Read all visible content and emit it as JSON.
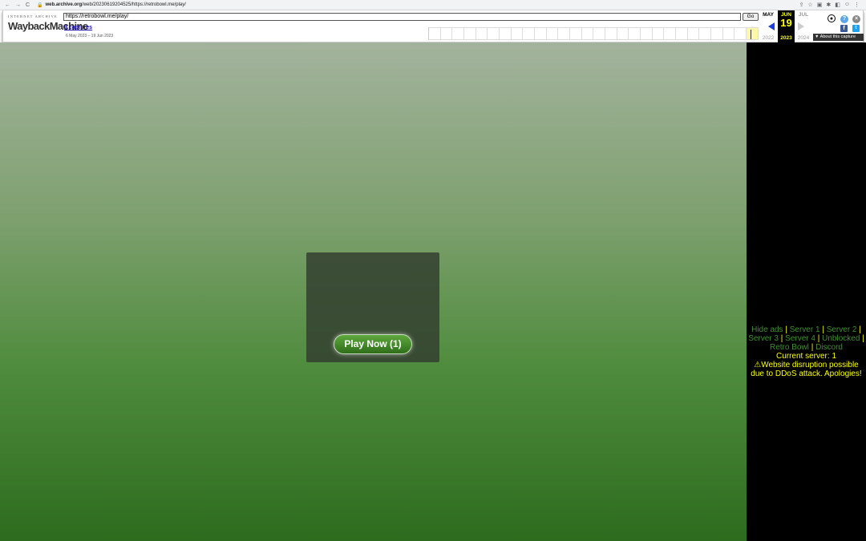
{
  "browser": {
    "url_host": "web.archive.org",
    "url_path": "/web/20230619204525/https://retrobowl.me/play/"
  },
  "wayback": {
    "logo_top": "INTERNET ARCHIVE",
    "logo_main_a": "Wayback",
    "logo_main_b": "Machine",
    "url_value": "https://retrobowl.me/play/",
    "go_label": "Go",
    "captures_label": "9 captures",
    "date_range": "6 May 2023 – 19 Jun 2023",
    "prev_month": "MAY",
    "prev_year": "2022",
    "cur_month": "JUN",
    "cur_day": "19",
    "cur_year": "2023",
    "next_month": "JUL",
    "next_year": "2024",
    "about_label": "▼ About this capture",
    "icons": [
      "user-icon",
      "help-icon",
      "close-icon",
      "facebook-icon",
      "twitter-icon"
    ]
  },
  "game": {
    "play_button": "Play Now (1)"
  },
  "sidebar": {
    "hide_ads": "Hide ads",
    "server1": "Server 1",
    "server2": "Server 2",
    "server3": "Server 3",
    "server4": "Server 4",
    "unblocked": "Unblocked",
    "retro_bowl": "Retro Bowl",
    "discord": "Discord",
    "sep": "|",
    "current_server": "Current server: 1",
    "warning": "⚠Website disruption possible due to DDoS attack. Apologies!"
  },
  "colors": {
    "link_green": "#3f8f2e",
    "warning_yellow": "#ffff00",
    "sidebar_bg": "#000000"
  }
}
